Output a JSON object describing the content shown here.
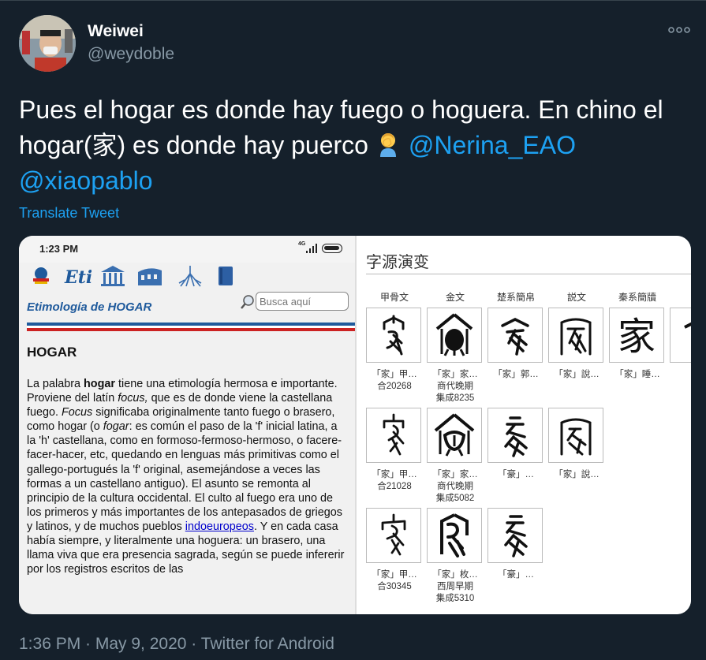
{
  "colors": {
    "background": "#15202b",
    "accent": "#1da1f2",
    "muted": "#8899a6"
  },
  "author": {
    "name": "Weiwei",
    "handle": "@weydoble"
  },
  "tweet": {
    "text_part1": "Pues el hogar es donde hay fuego o hoguera. En chino el hogar(家) es donde hay puerco ",
    "emoji": "face-palm-emoji",
    "mention1": "@Nerina_EAO",
    "mention2": "@xiaopablo",
    "translate_label": "Translate Tweet"
  },
  "phone": {
    "time": "1:23 PM",
    "network": "4G",
    "site_title": "Etimología de HOGAR",
    "search_placeholder": "Busca aquí",
    "heading": "HOGAR",
    "article_intro": "La palabra ",
    "article_bold": "hogar",
    "article_p1": " tiene una etimología hermosa e importante. Proviene del latín ",
    "article_focus": "focus,",
    "article_p2": " que es de donde viene la castellana fuego. ",
    "article_focus2": "Focus",
    "article_p3": " significaba originalmente tanto fuego o brasero, como hogar (o ",
    "article_fogar": "fogar",
    "article_p4": ": es común el paso de la 'f' inicial latina, a la 'h' castellana, como en formoso-fermoso-hermoso, o facere-facer-hacer, etc, quedando en lenguas más primitivas como el gallego-portugués la 'f' original, asemejándose a veces las formas a un castellano antiguo). El asunto se remonta al principio de la cultura occidental. El culto al fuego era uno de los primeros y más importantes de los antepasados de griegos y latinos, y de muchos pueblos ",
    "article_link": "indoeuropeos",
    "article_p5": ". Y en cada casa había siempre, y literalmente una hoguera: un brasero, una llama viva que era presencia sagrada, según se puede infererir por los registros escritos de las"
  },
  "zi": {
    "title": "字源演变",
    "columns": [
      "甲骨文",
      "金文",
      "楚系簡帛",
      "説文",
      "秦系簡牘"
    ],
    "cells": [
      {
        "glyph": "oracle-1",
        "caption": [
          "「家」甲…",
          "合20268"
        ]
      },
      {
        "glyph": "bronze-1",
        "caption": [
          "「家」家…",
          "商代晚期",
          "集成8235"
        ]
      },
      {
        "glyph": "chu-1",
        "caption": [
          "「家」郭…"
        ]
      },
      {
        "glyph": "shuowen-1",
        "caption": [
          "「家」說…"
        ]
      },
      {
        "glyph": "qin-1",
        "caption": [
          "「家」睡…"
        ]
      },
      {
        "glyph": "oracle-2",
        "caption": [
          "「家」甲…",
          "合21028"
        ]
      },
      {
        "glyph": "bronze-2",
        "caption": [
          "「家」家…",
          "商代晚期",
          "集成5082"
        ]
      },
      {
        "glyph": "chu-2",
        "caption": [
          "「豪」…"
        ]
      },
      {
        "glyph": "shuowen-2",
        "caption": [
          "「家」說…"
        ]
      },
      {
        "glyph": "oracle-3",
        "caption": [
          "「家」甲…",
          "合30345"
        ]
      },
      {
        "glyph": "bronze-3",
        "caption": [
          "「家」枚…",
          "西周早期",
          "集成5310"
        ]
      },
      {
        "glyph": "chu-3",
        "caption": [
          "「豪」…"
        ]
      }
    ],
    "qin_char": "家"
  },
  "meta": {
    "timestamp": "1:36 PM · May 9, 2020 · Twitter for Android"
  }
}
